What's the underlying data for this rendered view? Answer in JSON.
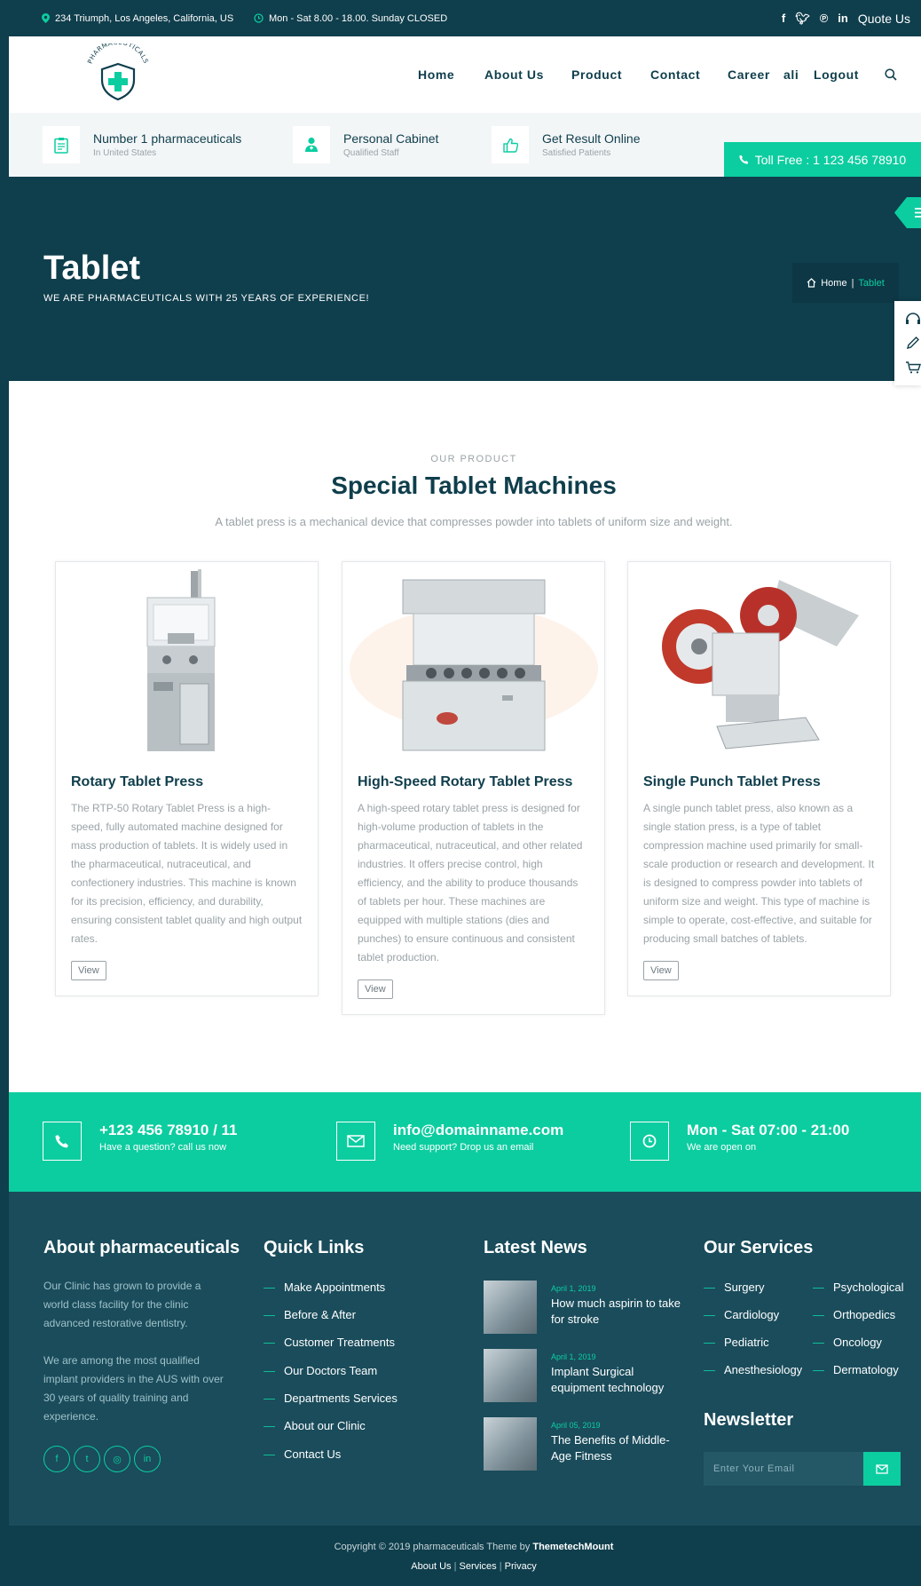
{
  "topbar": {
    "address": "234 Triumph, Los Angeles, California, US",
    "hours": "Mon - Sat 8.00 - 18.00. Sunday CLOSED",
    "quote": "Quote Us"
  },
  "header": {
    "logo_text": "PHARMACEUTICALS",
    "nav": [
      "Home",
      "About Us",
      "Product",
      "Contact",
      "Career",
      "ali",
      "Logout"
    ]
  },
  "features": [
    {
      "title": "Number 1 pharmaceuticals",
      "sub": "In United States"
    },
    {
      "title": "Personal Cabinet",
      "sub": "Qualified Staff"
    },
    {
      "title": "Get Result Online",
      "sub": "Satisfied Patients"
    }
  ],
  "tollfree": "Toll Free : 1 123 456 78910",
  "hero": {
    "title": "Tablet",
    "subtitle": "WE ARE PHARMACEUTICALS WITH 25 YEARS OF EXPERIENCE!",
    "crumb_home": "Home",
    "crumb_sep": "|",
    "crumb_current": "Tablet"
  },
  "products": {
    "label": "OUR PRODUCT",
    "title": "Special Tablet Machines",
    "description": "A tablet press is a mechanical device that compresses powder into tablets of uniform size and weight.",
    "items": [
      {
        "name": "Rotary Tablet Press",
        "text": "The RTP-50 Rotary Tablet Press is a high-speed, fully automated machine designed for mass production of tablets. It is widely used in the pharmaceutical, nutraceutical, and confectionery industries. This machine is known for its precision, efficiency, and durability, ensuring consistent tablet quality and high output rates.",
        "button": "View"
      },
      {
        "name": "High-Speed Rotary Tablet Press",
        "text": "A high-speed rotary tablet press is designed for high-volume production of tablets in the pharmaceutical, nutraceutical, and other related industries. It offers precise control, high efficiency, and the ability to produce thousands of tablets per hour. These machines are equipped with multiple stations (dies and punches) to ensure continuous and consistent tablet production.",
        "button": "View"
      },
      {
        "name": "Single Punch Tablet Press",
        "text": "A single punch tablet press, also known as a single station press, is a type of tablet compression machine used primarily for small-scale production or research and development. It is designed to compress powder into tablets of uniform size and weight. This type of machine is simple to operate, cost-effective, and suitable for producing small batches of tablets.",
        "button": "View"
      }
    ]
  },
  "cta": [
    {
      "main": "+123 456 78910 / 11",
      "sub": "Have a question? call us now"
    },
    {
      "main": "info@domainname.com",
      "sub": "Need support? Drop us an email"
    },
    {
      "main": "Mon - Sat 07:00 - 21:00",
      "sub": "We are open on"
    }
  ],
  "footer": {
    "about": {
      "heading": "About pharmaceuticals",
      "p1": "Our Clinic has grown to provide a world class facility for the clinic advanced restorative dentistry.",
      "p2": "We are among the most qualified implant providers in the AUS with over 30 years of quality training and experience."
    },
    "quick_links": {
      "heading": "Quick Links",
      "items": [
        "Make Appointments",
        "Before & After",
        "Customer Treatments",
        "Our Doctors Team",
        "Departments Services",
        "About our Clinic",
        "Contact Us"
      ]
    },
    "news": {
      "heading": "Latest News",
      "items": [
        {
          "date": "April 1, 2019",
          "title": "How much aspirin to take for stroke"
        },
        {
          "date": "April 1, 2019",
          "title": "Implant Surgical equipment technology"
        },
        {
          "date": "April 05, 2019",
          "title": "The Benefits of Middle-Age Fitness"
        }
      ]
    },
    "services": {
      "heading": "Our Services",
      "items": [
        "Surgery",
        "Psychological",
        "Cardiology",
        "Orthopedics",
        "Pediatric",
        "Oncology",
        "Anesthesiology",
        "Dermatology"
      ]
    },
    "newsletter": {
      "heading": "Newsletter",
      "placeholder": "Enter Your Email"
    }
  },
  "bottom": {
    "copyright": "Copyright © 2019 pharmaceuticals Theme by",
    "brand": "ThemetechMount",
    "links": [
      "About Us",
      "Services",
      "Privacy"
    ]
  },
  "colors": {
    "navy": "#0f3e4c",
    "accent": "#0ccda0",
    "footer": "#1a4c5b"
  }
}
